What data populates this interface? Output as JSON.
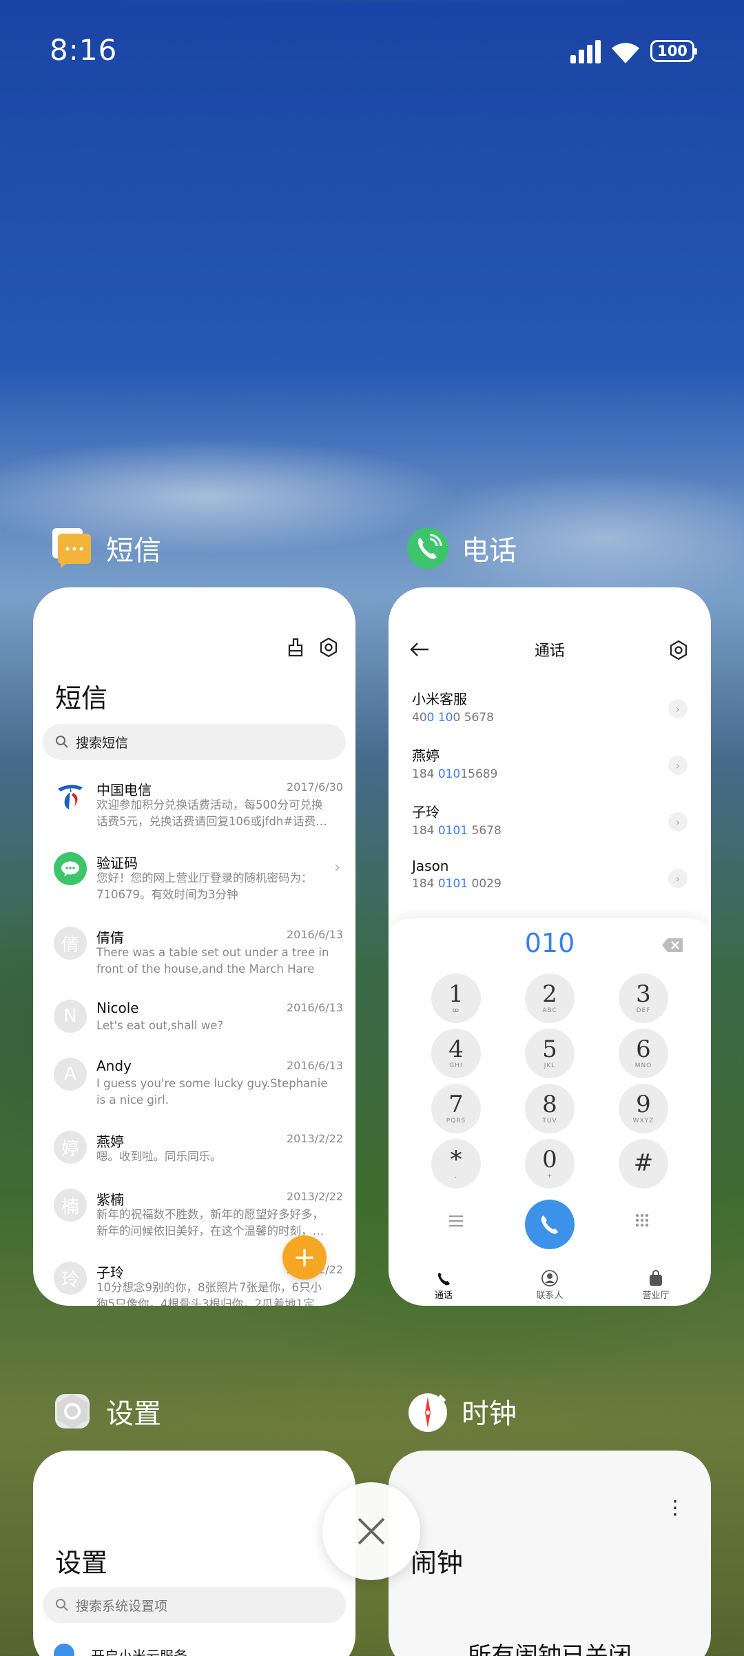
{
  "status_bar": {
    "time": "8:16",
    "battery": "100"
  },
  "sms": {
    "label": "短信",
    "title": "短信",
    "search_placeholder": "搜索短信",
    "messages": [
      {
        "avatar": "",
        "name": "中国电信",
        "date": "2017/6/30",
        "snippet": "欢迎参加积分兑换话费活动，每500分可兑换话费5元，兑换话费请回复106或jfdh#话费…"
      },
      {
        "avatar": "",
        "name": "验证码",
        "date": "",
        "snippet": "您好！您的网上营业厅登录的随机密码为：710679。有效时间为3分钟"
      },
      {
        "avatar": "倩",
        "name": "倩倩",
        "date": "2016/6/13",
        "snippet": "There was a table set out under a tree in front of the house,and the March Hare an…"
      },
      {
        "avatar": "N",
        "name": "Nicole",
        "date": "2016/6/13",
        "snippet": "Let's eat out,shall we?"
      },
      {
        "avatar": "A",
        "name": "Andy",
        "date": "2016/6/13",
        "snippet": "I guess you're some lucky guy.Stephanie is a nice girl."
      },
      {
        "avatar": "婷",
        "name": "燕婷",
        "date": "2013/2/22",
        "snippet": "嗯。收到啦。同乐同乐。"
      },
      {
        "avatar": "楠",
        "name": "紫楠",
        "date": "2013/2/22",
        "snippet": "新年的祝福数不胜数，新年的愿望好多好多，新年的问候依旧美好，在这个温馨的时刻，…"
      },
      {
        "avatar": "玲",
        "name": "子玲",
        "date": "2013/2/22",
        "snippet": "10分想念9别的你，8张照片7张是你，6只小狗5只像你，4根骨头3根归你，2瓜着地1定…"
      }
    ],
    "fab": "+"
  },
  "phone": {
    "label": "电话",
    "title": "通话",
    "contacts": [
      {
        "name": "小米客服",
        "num_pre": "40",
        "num_hl": "0 10",
        "num_post": "0 5678"
      },
      {
        "name": "燕婷",
        "num_pre": "184 ",
        "num_hl": "010",
        "num_post": "15689"
      },
      {
        "name": "子玲",
        "num_pre": "184 ",
        "num_hl": "0101",
        "num_post": " 5678"
      },
      {
        "name": "Jason",
        "num_pre": "184 ",
        "num_hl": "0101",
        "num_post": " 0029"
      }
    ],
    "dialed": "010",
    "keys": [
      {
        "d": "1",
        "l": "ꝏ"
      },
      {
        "d": "2",
        "l": "ABC"
      },
      {
        "d": "3",
        "l": "DEF"
      },
      {
        "d": "4",
        "l": "GHI"
      },
      {
        "d": "5",
        "l": "JKL"
      },
      {
        "d": "6",
        "l": "MNO"
      },
      {
        "d": "7",
        "l": "PQRS"
      },
      {
        "d": "8",
        "l": "TUV"
      },
      {
        "d": "9",
        "l": "WXYZ"
      },
      {
        "d": "*",
        "l": ","
      },
      {
        "d": "0",
        "l": "+"
      },
      {
        "d": "#",
        "l": ""
      }
    ],
    "tabs": [
      "通话",
      "联系人",
      "营业厅"
    ]
  },
  "settings": {
    "label": "设置",
    "title": "设置",
    "search_placeholder": "搜索系统设置项",
    "first_item": "开启小米云服务"
  },
  "clock": {
    "label": "时钟",
    "title": "闹钟",
    "empty_text": "所有闹钟已关闭"
  },
  "colors": {
    "accent_blue": "#3c7ef0",
    "fab_orange": "#f5a623",
    "wechat_green": "#3cc56b"
  }
}
